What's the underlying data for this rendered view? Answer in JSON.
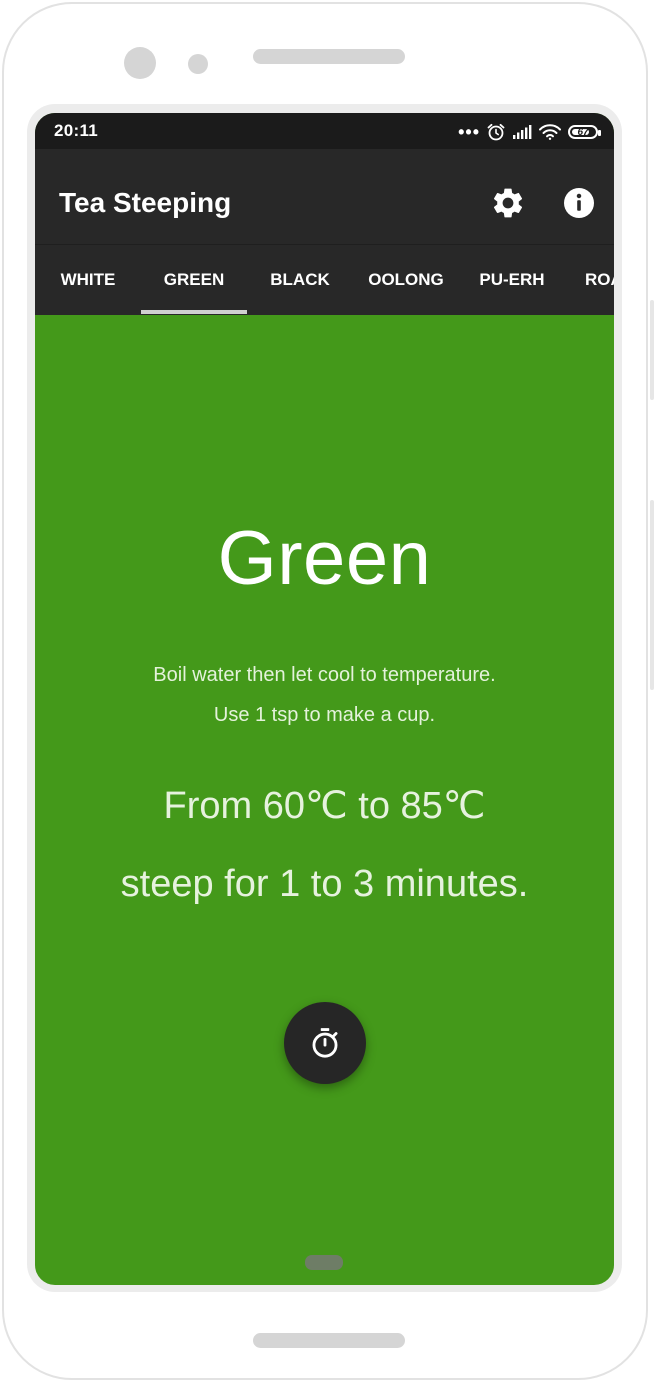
{
  "status_bar": {
    "time": "20:11",
    "overflow_dots": "•••",
    "battery_level": "67"
  },
  "app_bar": {
    "title": "Tea Steeping",
    "settings_icon": "gear-icon",
    "info_icon": "info-icon"
  },
  "tabs": [
    {
      "label": "WHITE"
    },
    {
      "label": "GREEN",
      "selected": true
    },
    {
      "label": "BLACK"
    },
    {
      "label": "OOLONG"
    },
    {
      "label": "PU-ERH"
    },
    {
      "label": "ROA"
    }
  ],
  "content": {
    "tea_name": "Green",
    "instruction_1": "Boil water then let cool to temperature.",
    "instruction_2": "Use 1 tsp to make a cup.",
    "temperature_line": "From 60℃ to 85℃",
    "steep_line": "steep for 1 to 3 minutes.",
    "timer_icon": "stopwatch-icon"
  },
  "colors": {
    "background": "#44991a",
    "app_bar": "#282828",
    "status_bar": "#1b1b1b",
    "fab": "#262626",
    "text": "#ffffff"
  }
}
